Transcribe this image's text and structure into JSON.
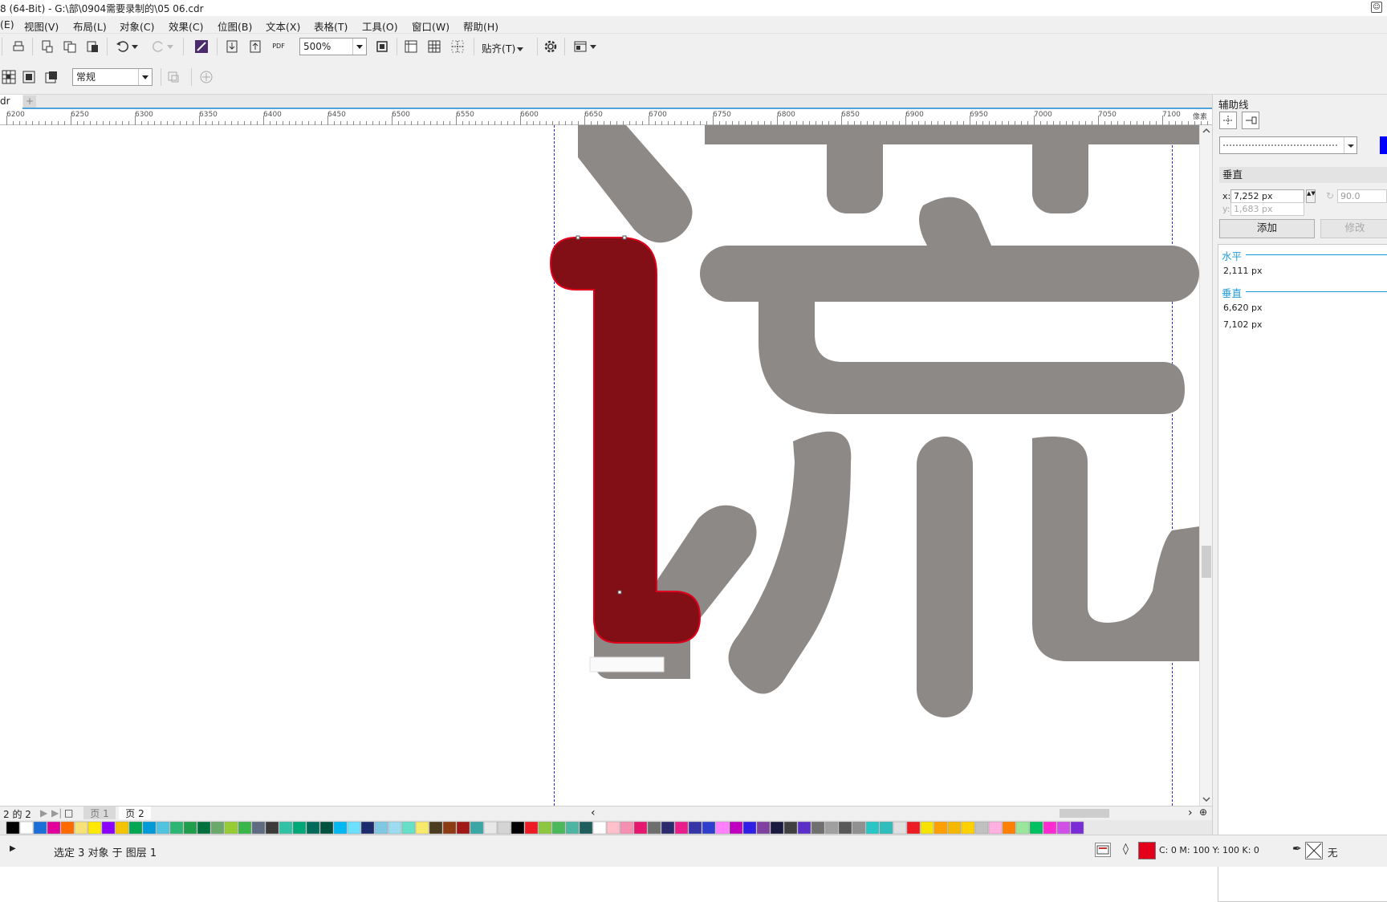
{
  "window": {
    "title": "8 (64-Bit) - G:\\部\\0904需要录制的\\05 06.cdr"
  },
  "menu": [
    "(E)",
    "视图(V)",
    "布局(L)",
    "对象(C)",
    "效果(C)",
    "位图(B)",
    "文本(X)",
    "表格(T)",
    "工具(O)",
    "窗口(W)",
    "帮助(H)"
  ],
  "toolbar": {
    "zoom_value": "500%",
    "snap_label": "贴齐(T)",
    "pdf_label": "PDF"
  },
  "property_bar": {
    "style_value": "常规"
  },
  "doc_tab": {
    "label": "dr"
  },
  "ruler": {
    "ticks": [
      "6200",
      "6250",
      "6300",
      "6350",
      "6400",
      "6450",
      "6500",
      "6550",
      "6600",
      "6650",
      "6700",
      "6750",
      "6800",
      "6850",
      "6900",
      "6950",
      "7000",
      "7050",
      "7100"
    ],
    "unit": "像素"
  },
  "page_nav": {
    "counter": "2 的 2",
    "tabs": [
      "页 1",
      "页 2"
    ]
  },
  "palette": {
    "colors": [
      "#000000",
      "#ffffff",
      "#1b6fd6",
      "#e3009a",
      "#ff6a00",
      "#f7e27a",
      "#ffe900",
      "#8b00ff",
      "#f5c400",
      "#00a651",
      "#009ad9",
      "#4fc3e0",
      "#2bb673",
      "#1e9d4b",
      "#00703c",
      "#6ba86b",
      "#98cc33",
      "#39b54a",
      "#5e6b80",
      "#3b3b3b",
      "#30c2a6",
      "#00a878",
      "#006b5b",
      "#00523f",
      "#00b9f2",
      "#6be0ff",
      "#1d2a6d",
      "#7ec8e3",
      "#9ddcf0",
      "#65e0c8",
      "#f7ea6a",
      "#4b3b1f",
      "#8c3b12",
      "#a01818",
      "#3aa6a6",
      "#e8e8e8",
      "#d4d4d4",
      "#000000",
      "#ed1c24",
      "#8dc63f",
      "#4cb85c",
      "#4db6a2",
      "#1f5e5e",
      "#ffffff",
      "#ffc0cb",
      "#f78fb3",
      "#e5176e",
      "#6e6e6e",
      "#2b2b6d",
      "#e91e8c",
      "#3535a8",
      "#2f3ecf",
      "#ff7fff",
      "#c000c0",
      "#2e1ee6",
      "#8040a0",
      "#1a1a40",
      "#404040",
      "#5b2fc8",
      "#707070",
      "#a0a0a0",
      "#585858",
      "#909090",
      "#28c6c6",
      "#30bdbd",
      "#e0e0e0",
      "#ed1c24",
      "#f7e300",
      "#ff9f00",
      "#f5b800",
      "#ffd000",
      "#c0c0c0",
      "#ffb0e0",
      "#ff7f00",
      "#9ae69a",
      "#00c060",
      "#ff2bd0",
      "#d04fe6",
      "#7a2dd6"
    ]
  },
  "status": {
    "message": "选定 3 对象 于 图层 1",
    "fill_info": "C: 0 M: 100 Y: 100 K: 0",
    "fill_color": "#e3001b",
    "outline_label": "无"
  },
  "docker": {
    "title": "辅助线",
    "section_title": "垂直",
    "x_label": "x:",
    "x_value": "7,252 px",
    "y_label": "y:",
    "y_value": "1,683 px",
    "angle_value": "90.0",
    "add_button": "添加",
    "modify_button": "修改",
    "groups": [
      {
        "heading": "水平",
        "items": [
          "2,111 px"
        ]
      },
      {
        "heading": "垂直",
        "items": [
          "6,620 px",
          "7,102 px"
        ]
      }
    ]
  }
}
